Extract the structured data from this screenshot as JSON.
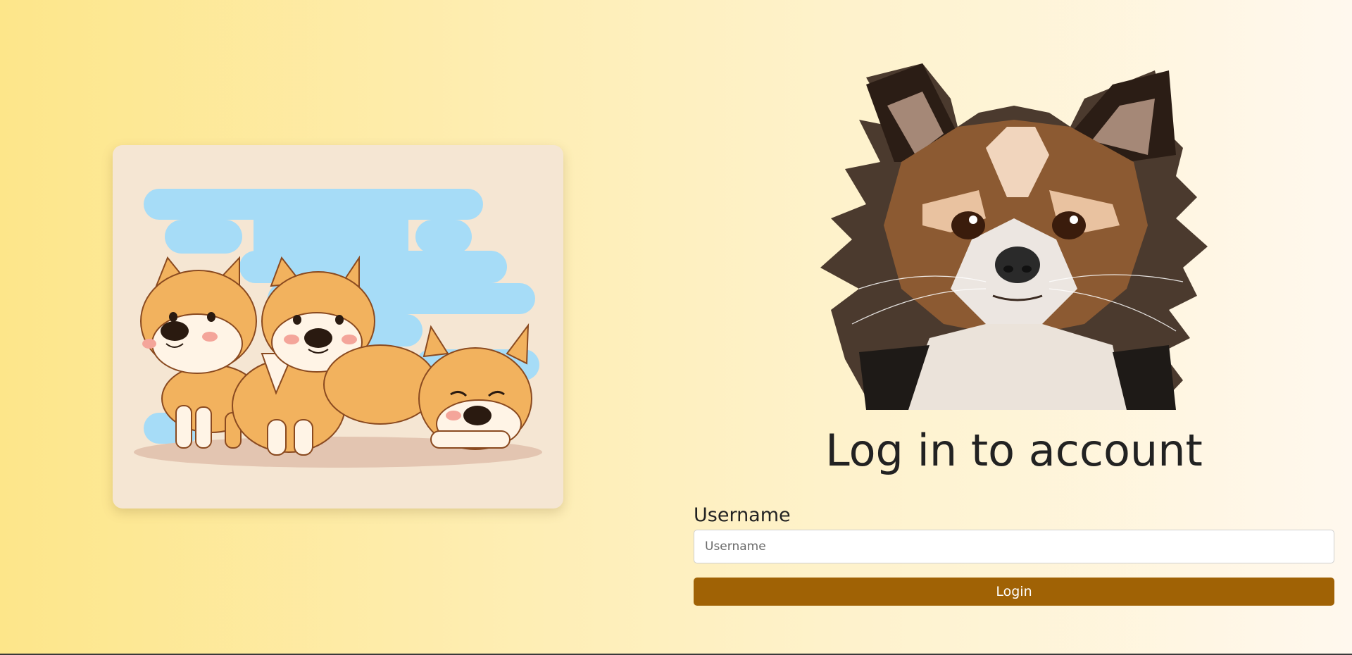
{
  "login": {
    "title": "Log in to account",
    "username_label": "Username",
    "username_placeholder": "Username",
    "username_value": "",
    "login_button_label": "Login"
  },
  "colors": {
    "background_gradient_start": "#fde68a",
    "background_gradient_end": "#fff8ee",
    "card_background": "#f5e6d3",
    "button_background": "#a06205",
    "button_text": "#ffffff",
    "title_text": "#222222"
  },
  "images": {
    "illustration": "shiba-puppies-illustration",
    "portrait": "chihuahua-portrait"
  }
}
